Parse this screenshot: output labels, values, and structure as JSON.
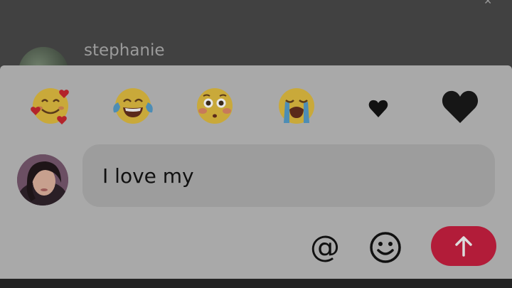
{
  "background_post": {
    "username": "stephanie",
    "corner_icon": "close-icon",
    "corner_glyph": "✕"
  },
  "quick_reactions": [
    {
      "name": "smiling-face-with-hearts",
      "icon": "smiling-face-with-hearts-icon"
    },
    {
      "name": "face-with-tears-of-joy",
      "icon": "face-with-tears-of-joy-icon"
    },
    {
      "name": "flushed-face",
      "icon": "flushed-face-icon"
    },
    {
      "name": "loudly-crying-face",
      "icon": "loudly-crying-face-icon"
    },
    {
      "name": "black-heart-suit",
      "icon": "heart-suit-icon"
    },
    {
      "name": "black-heart",
      "icon": "black-heart-icon"
    }
  ],
  "composer": {
    "avatar": "user-avatar",
    "input_value": "I love my",
    "at_glyph": "@",
    "mention_icon": "at-icon",
    "emoji_icon": "smiley-icon",
    "send_icon": "arrow-up-icon"
  },
  "colors": {
    "send_button": "#b21c39",
    "sheet": "#a9a9a9",
    "input": "#9d9d9d",
    "overlay": "#3f3f3f"
  }
}
